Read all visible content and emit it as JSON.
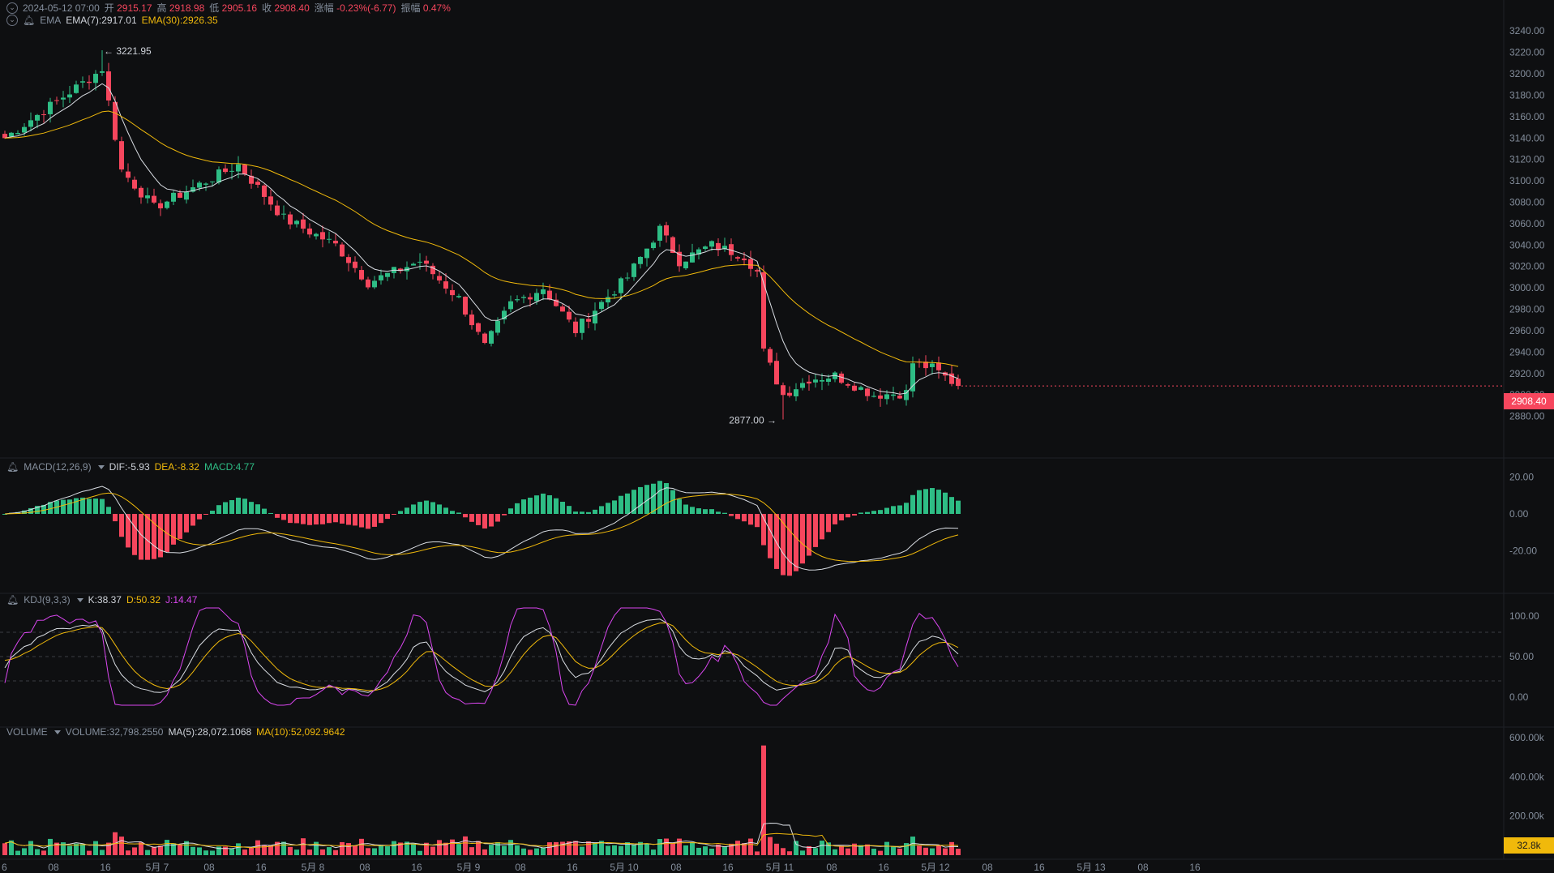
{
  "theme": {
    "bg": "#0e0f11",
    "up": "#2ebd85",
    "down": "#f6465d",
    "grid": "#1e2026",
    "axis_text": "#848e9c",
    "ema7": "#d9dde3",
    "ema30": "#f0b90b",
    "kdj_j": "#d946ef",
    "volume_tag": "#f0b90b"
  },
  "ohlc_header": {
    "time": "2024-05-12 07:00",
    "open_label": "开",
    "open": "2915.17",
    "high_label": "高",
    "high": "2918.98",
    "low_label": "低",
    "low": "2905.16",
    "close_label": "收",
    "close": "2908.40",
    "change_label": "涨幅",
    "change": "-0.23%(-6.77)",
    "amp_label": "振幅",
    "amp": "0.47%"
  },
  "ema_header": {
    "name": "EMA",
    "ema7": "EMA(7):2917.01",
    "ema30": "EMA(30):2926.35"
  },
  "macd_header": {
    "name": "MACD(12,26,9)",
    "dif": "DIF:-5.93",
    "dea": "DEA:-8.32",
    "macd": "MACD:4.77"
  },
  "kdj_header": {
    "name": "KDJ(9,3,3)",
    "k": "K:38.37",
    "d": "D:50.32",
    "j": "J:14.47"
  },
  "vol_header": {
    "name": "VOLUME",
    "volume": "VOLUME:32,798.2550",
    "ma5": "MA(5):28,072.1068",
    "ma10": "MA(10):52,092.9642"
  },
  "annotations": {
    "high_mark": "← 3221.95",
    "low_mark": "2877.00 →"
  },
  "price_tag": "2908.40",
  "volume_tag": "32.8k",
  "price_axis": [
    "3240.00",
    "3220.00",
    "3200.00",
    "3180.00",
    "3160.00",
    "3140.00",
    "3120.00",
    "3100.00",
    "3080.00",
    "3060.00",
    "3040.00",
    "3020.00",
    "3000.00",
    "2980.00",
    "2960.00",
    "2940.00",
    "2920.00",
    "2900.00",
    "2880.00"
  ],
  "macd_axis": [
    "20.00",
    "0.00",
    "-20.00"
  ],
  "kdj_axis": [
    "100.00",
    "50.00",
    "0.00"
  ],
  "vol_axis": [
    "600.00k",
    "400.00k",
    "200.00k"
  ],
  "time_axis": [
    "6",
    "08",
    "16",
    "5月 7",
    "08",
    "16",
    "5月 8",
    "08",
    "16",
    "5月 9",
    "08",
    "16",
    "5月 10",
    "08",
    "16",
    "5月 11",
    "08",
    "16",
    "5月 12",
    "08",
    "16",
    "5月 13",
    "08",
    "16"
  ],
  "chart_data": {
    "type": "candlestick",
    "interval_hours": 1,
    "start": "2024-05-06 04:00",
    "price_range": [
      2860,
      3250
    ],
    "key_points": [
      {
        "t": "2024-05-06 04:00",
        "close": 3140
      },
      {
        "t": "2024-05-06 18:00",
        "close": 3200
      },
      {
        "t": "2024-05-06 19:00",
        "high": 3221.95,
        "close": 3205
      },
      {
        "t": "2024-05-06 22:00",
        "close": 3110
      },
      {
        "t": "2024-05-07 03:00",
        "close": 3075
      },
      {
        "t": "2024-05-07 16:00",
        "close": 3115
      },
      {
        "t": "2024-05-07 23:00",
        "close": 3065
      },
      {
        "t": "2024-05-08 07:00",
        "close": 3040
      },
      {
        "t": "2024-05-08 12:00",
        "close": 3005
      },
      {
        "t": "2024-05-08 20:00",
        "close": 3025
      },
      {
        "t": "2024-05-09 02:00",
        "close": 2990
      },
      {
        "t": "2024-05-09 06:00",
        "close": 2945
      },
      {
        "t": "2024-05-09 10:00",
        "close": 2985
      },
      {
        "t": "2024-05-09 15:00",
        "close": 3000
      },
      {
        "t": "2024-05-09 20:00",
        "close": 2960
      },
      {
        "t": "2024-05-09 23:00",
        "close": 2980
      },
      {
        "t": "2024-05-10 04:00",
        "close": 3010
      },
      {
        "t": "2024-05-10 09:00",
        "close": 3055
      },
      {
        "t": "2024-05-10 12:00",
        "close": 3025
      },
      {
        "t": "2024-05-10 17:00",
        "close": 3040
      },
      {
        "t": "2024-05-10 22:00",
        "close": 3030
      },
      {
        "t": "2024-05-11 00:00",
        "close": 3015
      },
      {
        "t": "2024-05-11 01:00",
        "close": 2940
      },
      {
        "t": "2024-05-11 04:00",
        "low": 2877.0,
        "close": 2900
      },
      {
        "t": "2024-05-11 08:00",
        "close": 2915
      },
      {
        "t": "2024-05-11 12:00",
        "close": 2918
      },
      {
        "t": "2024-05-11 18:00",
        "close": 2900
      },
      {
        "t": "2024-05-11 23:00",
        "close": 2902
      },
      {
        "t": "2024-05-12 00:00",
        "close": 2930
      },
      {
        "t": "2024-05-12 03:00",
        "close": 2925
      },
      {
        "t": "2024-05-12 07:00",
        "open": 2915.17,
        "high": 2918.98,
        "low": 2905.16,
        "close": 2908.4
      }
    ],
    "last": {
      "ema7": 2917.01,
      "ema30": 2926.35,
      "dif": -5.93,
      "dea": -8.32,
      "macd": 4.77,
      "k": 38.37,
      "d": 50.32,
      "j": 14.47,
      "volume": 32798.255,
      "vol_ma5": 28072.1068,
      "vol_ma10": 52092.9642
    },
    "volume_spike": {
      "t": "2024-05-11 01:00",
      "volume": 560000
    }
  }
}
